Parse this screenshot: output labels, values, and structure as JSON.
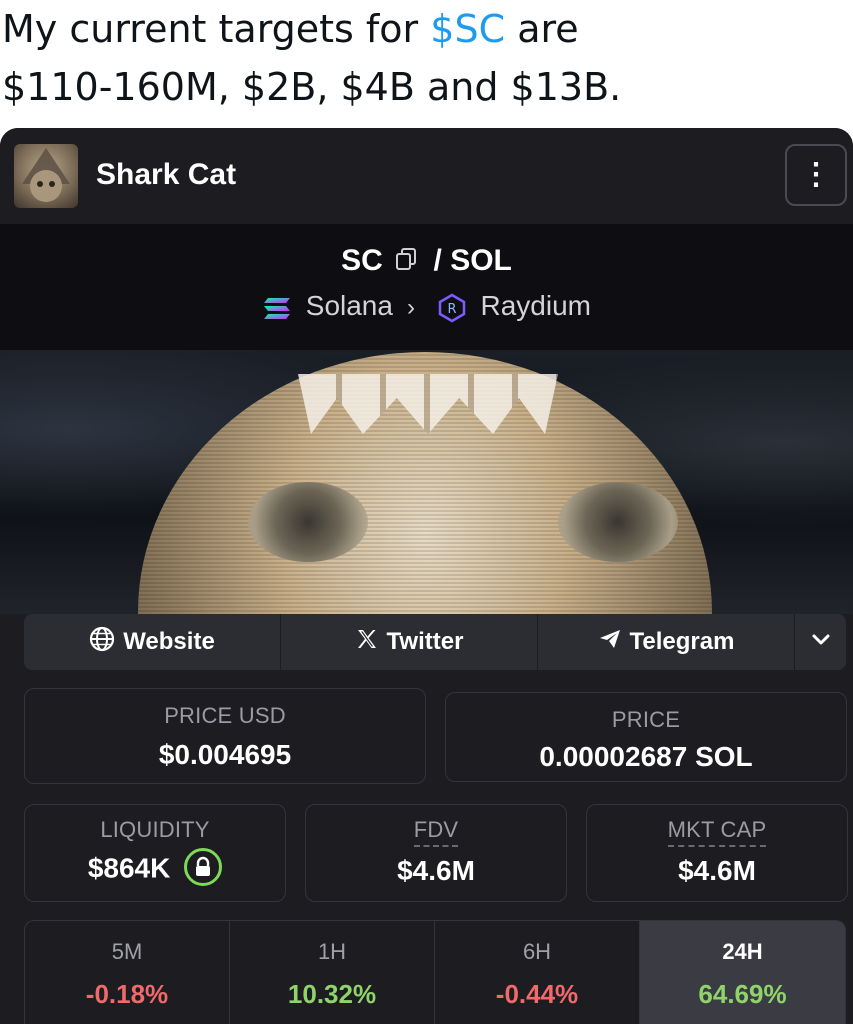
{
  "tweet": {
    "line1_prefix": "My current targets for ",
    "cashtag": "$SC",
    "line1_suffix": " are",
    "line2": "$110-160M, $2B, $4B and $13B."
  },
  "card": {
    "token_name": "Shark Cat",
    "menu_icon": "more-vertical-icon",
    "pair": {
      "base": "SC",
      "separator": "/",
      "quote": "SOL"
    },
    "chain": {
      "network": "Solana",
      "dex": "Raydium"
    },
    "links": {
      "website": "Website",
      "twitter": "Twitter",
      "telegram": "Telegram"
    },
    "price_usd": {
      "label": "PRICE USD",
      "value": "$0.004695"
    },
    "price": {
      "label": "PRICE",
      "value": "0.00002687 SOL"
    },
    "liquidity": {
      "label": "LIQUIDITY",
      "value": "$864K"
    },
    "fdv": {
      "label": "FDV",
      "value": "$4.6M"
    },
    "mkt_cap": {
      "label": "MKT CAP",
      "value": "$4.6M"
    },
    "changes": [
      {
        "period": "5M",
        "value": "-0.18%",
        "trend": "negative"
      },
      {
        "period": "1H",
        "value": "10.32%",
        "trend": "positive"
      },
      {
        "period": "6H",
        "value": "-0.44%",
        "trend": "negative"
      },
      {
        "period": "24H",
        "value": "64.69%",
        "trend": "positive",
        "selected": true
      }
    ],
    "colors": {
      "card_bg": "#1c1c21",
      "positive": "#8fd46a",
      "negative": "#f06a6a",
      "cashtag": "#1d9bf0"
    }
  }
}
